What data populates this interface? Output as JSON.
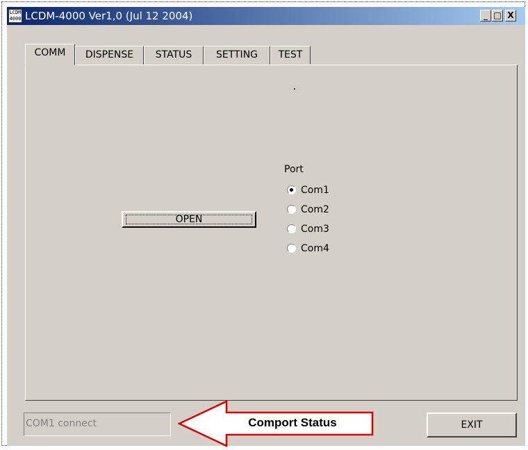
{
  "window": {
    "title": "LCDM-4000 Ver1,0 (Jul 12 2004)",
    "icon_text_top": "LCDM",
    "icon_text_bottom": "4000",
    "minimize_glyph": "_",
    "maximize_glyph": "□",
    "close_glyph": "X"
  },
  "tabs": [
    {
      "label": "COMM",
      "active": true
    },
    {
      "label": "DISPENSE",
      "active": false
    },
    {
      "label": "STATUS",
      "active": false
    },
    {
      "label": "SETTING",
      "active": false
    },
    {
      "label": "TEST",
      "active": false
    }
  ],
  "comm": {
    "open_button": "OPEN",
    "port_label": "Port",
    "ports": [
      {
        "label": "Com1",
        "checked": true
      },
      {
        "label": "Com2",
        "checked": false
      },
      {
        "label": "Com3",
        "checked": false
      },
      {
        "label": "Com4",
        "checked": false
      }
    ]
  },
  "footer": {
    "status_value": "COM1 connect",
    "exit_button": "EXIT"
  },
  "annotation": {
    "callout_text": "Comport Status",
    "arrow_color": "#e00000"
  },
  "colors": {
    "titlebar_start": "#0a246a",
    "titlebar_end": "#a6caf0",
    "face": "#d4d0c8"
  }
}
